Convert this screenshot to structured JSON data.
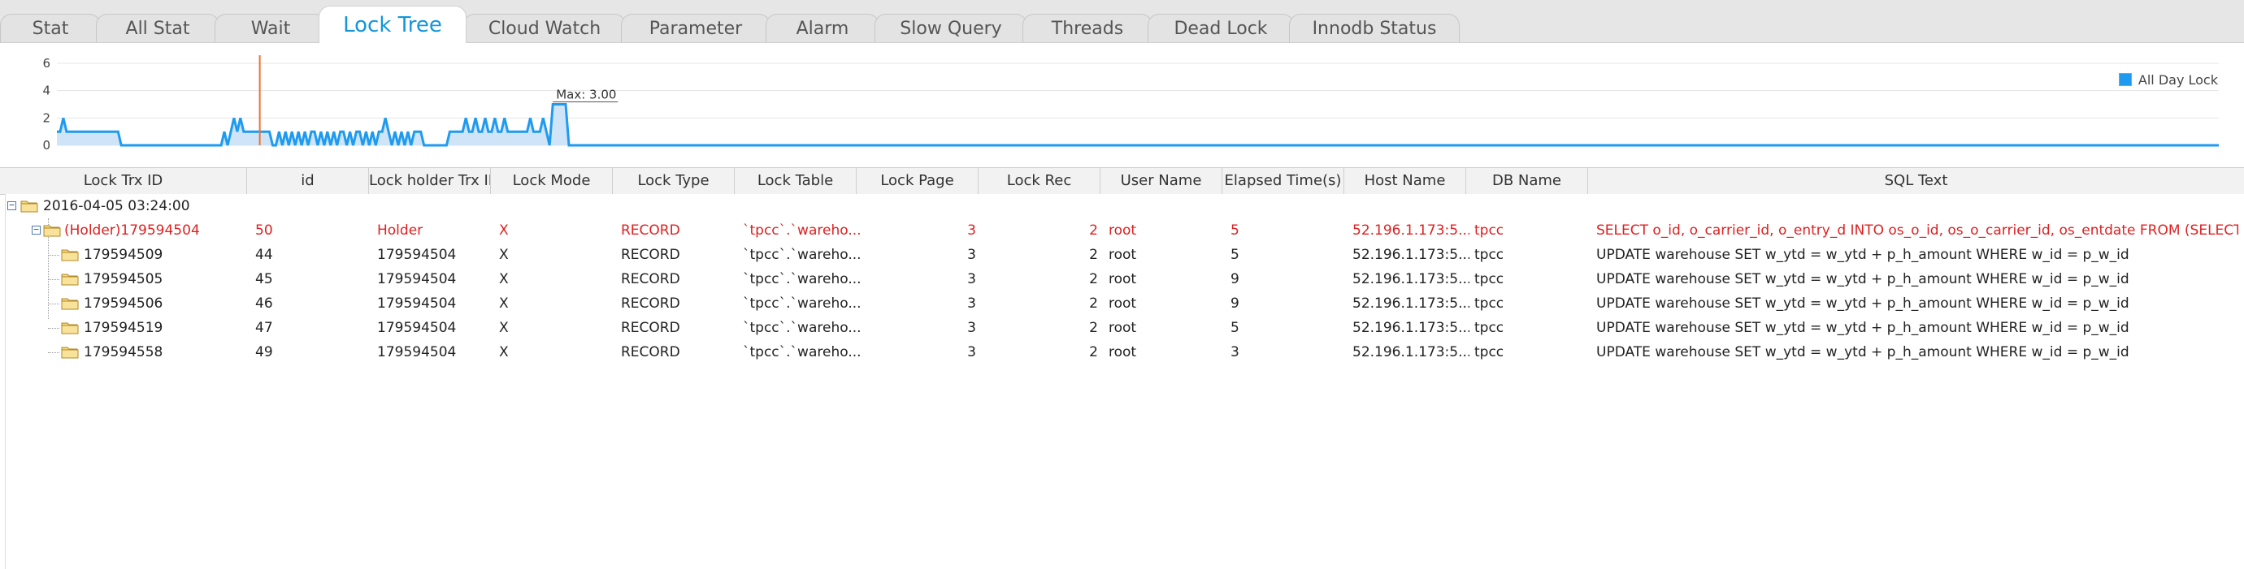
{
  "tabs": [
    {
      "label": "Stat",
      "active": false
    },
    {
      "label": "All Stat",
      "active": false
    },
    {
      "label": "Wait",
      "active": false
    },
    {
      "label": "Lock Tree",
      "active": true
    },
    {
      "label": "Cloud Watch",
      "active": false
    },
    {
      "label": "Parameter",
      "active": false
    },
    {
      "label": "Alarm",
      "active": false
    },
    {
      "label": "Slow Query",
      "active": false
    },
    {
      "label": "Threads",
      "active": false
    },
    {
      "label": "Dead Lock",
      "active": false
    },
    {
      "label": "Innodb Status",
      "active": false
    }
  ],
  "chart": {
    "legend_label": "All Day Lock",
    "max_label": "Max:  3.00",
    "y_ticks": [
      "6",
      "4",
      "2",
      "0"
    ],
    "series_color": "#1e9bf0",
    "fill_color": "#cfe4f7",
    "marker_color": "#f07030"
  },
  "chart_data": {
    "type": "area",
    "series": [
      {
        "name": "All Day Lock",
        "values": [
          1,
          1,
          2,
          1,
          1,
          1,
          1,
          1,
          1,
          1,
          1,
          1,
          1,
          1,
          1,
          1,
          1,
          1,
          1,
          1,
          0,
          0,
          0,
          0,
          0,
          0,
          0,
          0,
          0,
          0,
          0,
          0,
          0,
          0,
          0,
          0,
          0,
          0,
          0,
          0,
          0,
          0,
          0,
          0,
          0,
          0,
          0,
          0,
          0,
          0,
          0,
          0,
          1,
          0,
          1,
          2,
          1,
          2,
          1,
          1,
          1,
          1,
          1,
          1,
          1,
          1,
          1,
          0,
          0,
          1,
          0,
          1,
          0,
          1,
          0,
          1,
          0,
          1,
          0,
          1,
          1,
          0,
          1,
          0,
          1,
          0,
          1,
          0,
          1,
          1,
          0,
          1,
          0,
          1,
          1,
          0,
          1,
          0,
          1,
          0,
          1,
          1,
          2,
          1,
          0,
          1,
          0,
          1,
          0,
          1,
          0,
          1,
          1,
          1,
          0,
          0,
          0,
          0,
          0,
          0,
          0,
          0,
          1,
          1,
          1,
          1,
          1,
          2,
          1,
          1,
          2,
          1,
          1,
          2,
          1,
          1,
          2,
          1,
          1,
          2,
          1,
          1,
          1,
          1,
          1,
          1,
          1,
          2,
          1,
          1,
          1,
          2,
          1,
          0,
          3,
          3,
          3,
          3,
          3,
          0
        ]
      }
    ],
    "ylim": [
      0,
      6
    ],
    "yticks": [
      0,
      2,
      4,
      6
    ],
    "max_value": 3.0,
    "grid": true,
    "legend": "top-right"
  },
  "grid": {
    "columns": [
      "Lock Trx ID",
      "id",
      "Lock holder Trx ID",
      "Lock Mode",
      "Lock Type",
      "Lock Table",
      "Lock Page",
      "Lock Rec",
      "User Name",
      "Elapsed Time(s)",
      "Host Name",
      "DB Name",
      "SQL Text"
    ],
    "group_label": "2016-04-05 03:24:00",
    "holder": {
      "trx": "(Holder)179594504",
      "id": "50",
      "holder": "Holder",
      "mode": "X",
      "type": "RECORD",
      "table": "`tpcc`.`wareho...",
      "page": "3",
      "rec": "2",
      "user": "root",
      "elapsed": "5",
      "host": "52.196.1.173:5...",
      "db": "tpcc",
      "sql": "SELECT o_id, o_carrier_id, o_entry_d INTO os_o_id, os_o_carrier_id, os_entdate FROM (SELECT o_id, o_..."
    },
    "waiters": [
      {
        "trx": "179594509",
        "id": "44",
        "holder": "179594504",
        "mode": "X",
        "type": "RECORD",
        "table": "`tpcc`.`wareho...",
        "page": "3",
        "rec": "2",
        "user": "root",
        "elapsed": "5",
        "host": "52.196.1.173:5...",
        "db": "tpcc",
        "sql": "UPDATE warehouse SET w_ytd = w_ytd + p_h_amount WHERE w_id = p_w_id"
      },
      {
        "trx": "179594505",
        "id": "45",
        "holder": "179594504",
        "mode": "X",
        "type": "RECORD",
        "table": "`tpcc`.`wareho...",
        "page": "3",
        "rec": "2",
        "user": "root",
        "elapsed": "9",
        "host": "52.196.1.173:5...",
        "db": "tpcc",
        "sql": "UPDATE warehouse SET w_ytd = w_ytd + p_h_amount WHERE w_id = p_w_id"
      },
      {
        "trx": "179594506",
        "id": "46",
        "holder": "179594504",
        "mode": "X",
        "type": "RECORD",
        "table": "`tpcc`.`wareho...",
        "page": "3",
        "rec": "2",
        "user": "root",
        "elapsed": "9",
        "host": "52.196.1.173:5...",
        "db": "tpcc",
        "sql": "UPDATE warehouse SET w_ytd = w_ytd + p_h_amount WHERE w_id = p_w_id"
      },
      {
        "trx": "179594519",
        "id": "47",
        "holder": "179594504",
        "mode": "X",
        "type": "RECORD",
        "table": "`tpcc`.`wareho...",
        "page": "3",
        "rec": "2",
        "user": "root",
        "elapsed": "5",
        "host": "52.196.1.173:5...",
        "db": "tpcc",
        "sql": "UPDATE warehouse SET w_ytd = w_ytd + p_h_amount WHERE w_id = p_w_id"
      },
      {
        "trx": "179594558",
        "id": "49",
        "holder": "179594504",
        "mode": "X",
        "type": "RECORD",
        "table": "`tpcc`.`wareho...",
        "page": "3",
        "rec": "2",
        "user": "root",
        "elapsed": "3",
        "host": "52.196.1.173:5...",
        "db": "tpcc",
        "sql": "UPDATE warehouse SET w_ytd = w_ytd + p_h_amount WHERE w_id = p_w_id"
      }
    ]
  }
}
